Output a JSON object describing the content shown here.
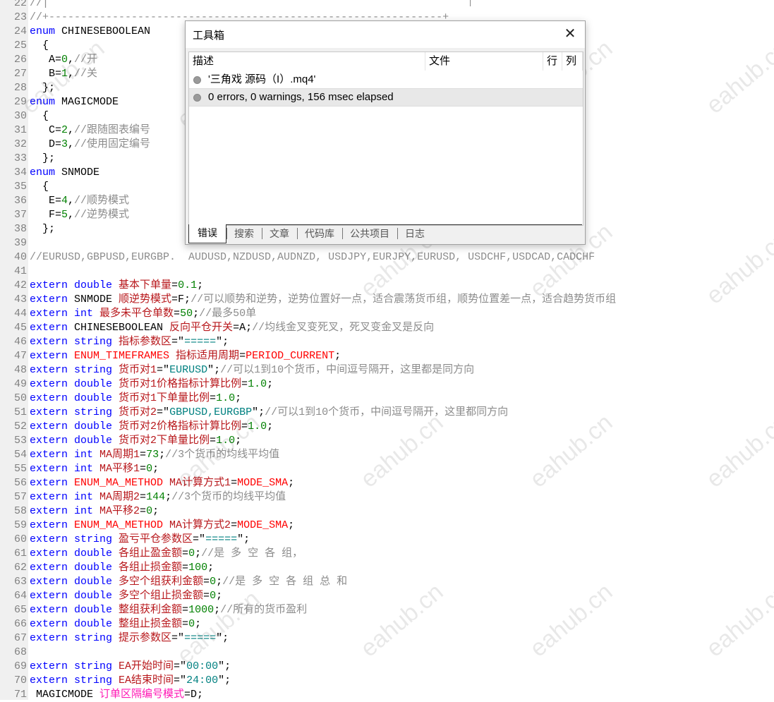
{
  "editor": {
    "lines": [
      {
        "no": "22",
        "seg": [
          [
            "c",
            "//|"
          ]
        ],
        "vbar": true
      },
      {
        "no": "23",
        "seg": [
          [
            "c",
            "//+--------------------------------------------------------------+"
          ]
        ]
      },
      {
        "no": "24",
        "seg": [
          [
            "k",
            "enum"
          ],
          [
            "p",
            " CHINESEBOOLEAN"
          ]
        ]
      },
      {
        "no": "25",
        "seg": [
          [
            "p",
            "  {"
          ]
        ]
      },
      {
        "no": "26",
        "seg": [
          [
            "p",
            "   A="
          ],
          [
            "n",
            "0"
          ],
          [
            "p",
            ","
          ],
          [
            "c",
            "//开"
          ]
        ]
      },
      {
        "no": "27",
        "seg": [
          [
            "p",
            "   B="
          ],
          [
            "n",
            "1"
          ],
          [
            "p",
            ","
          ],
          [
            "c",
            "//关"
          ]
        ]
      },
      {
        "no": "28",
        "seg": [
          [
            "p",
            "  };"
          ]
        ]
      },
      {
        "no": "29",
        "seg": [
          [
            "k",
            "enum"
          ],
          [
            "p",
            " MAGICMODE"
          ]
        ]
      },
      {
        "no": "30",
        "seg": [
          [
            "p",
            "  {"
          ]
        ]
      },
      {
        "no": "31",
        "seg": [
          [
            "p",
            "   C="
          ],
          [
            "n",
            "2"
          ],
          [
            "p",
            ","
          ],
          [
            "c",
            "//跟随图表编号"
          ]
        ]
      },
      {
        "no": "32",
        "seg": [
          [
            "p",
            "   D="
          ],
          [
            "n",
            "3"
          ],
          [
            "p",
            ","
          ],
          [
            "c",
            "//使用固定编号"
          ]
        ]
      },
      {
        "no": "33",
        "seg": [
          [
            "p",
            "  };"
          ]
        ]
      },
      {
        "no": "34",
        "seg": [
          [
            "k",
            "enum"
          ],
          [
            "p",
            " SNMODE"
          ]
        ]
      },
      {
        "no": "35",
        "seg": [
          [
            "p",
            "  {"
          ]
        ]
      },
      {
        "no": "36",
        "seg": [
          [
            "p",
            "   E="
          ],
          [
            "n",
            "4"
          ],
          [
            "p",
            ","
          ],
          [
            "c",
            "//顺势模式"
          ]
        ]
      },
      {
        "no": "37",
        "seg": [
          [
            "p",
            "   F="
          ],
          [
            "n",
            "5"
          ],
          [
            "p",
            ","
          ],
          [
            "c",
            "//逆势模式"
          ]
        ]
      },
      {
        "no": "38",
        "seg": [
          [
            "p",
            "  };"
          ]
        ]
      },
      {
        "no": "39",
        "seg": []
      },
      {
        "no": "40",
        "seg": [
          [
            "c",
            "//EURUSD,GBPUSD,EURGBP.  AUDUSD,NZDUSD,AUDNZD, USDJPY,EURJPY,EURUSD, USDCHF,USDCAD,CADCHF"
          ]
        ]
      },
      {
        "no": "41",
        "seg": []
      },
      {
        "no": "42",
        "seg": [
          [
            "k",
            "extern double "
          ],
          [
            "v",
            "基本下单量"
          ],
          [
            "p",
            "="
          ],
          [
            "n",
            "0.1"
          ],
          [
            "p",
            ";"
          ]
        ]
      },
      {
        "no": "43",
        "seg": [
          [
            "k",
            "extern "
          ],
          [
            "t",
            "SNMODE "
          ],
          [
            "v",
            "顺逆势模式"
          ],
          [
            "p",
            "=F;"
          ],
          [
            "c",
            "//可以顺势和逆势，逆势位置好一点，适合震荡货币组，顺势位置差一点，适合趋势货币组"
          ]
        ]
      },
      {
        "no": "44",
        "seg": [
          [
            "k",
            "extern int "
          ],
          [
            "v",
            "最多未平仓单数"
          ],
          [
            "p",
            "="
          ],
          [
            "n",
            "50"
          ],
          [
            "p",
            ";"
          ],
          [
            "c",
            "//最多50单"
          ]
        ]
      },
      {
        "no": "45",
        "seg": [
          [
            "k",
            "extern "
          ],
          [
            "t",
            "CHINESEBOOLEAN "
          ],
          [
            "v",
            "反向平仓开关"
          ],
          [
            "p",
            "=A;"
          ],
          [
            "c",
            "//均线金叉变死叉，死叉变金叉是反向"
          ]
        ]
      },
      {
        "no": "46",
        "seg": [
          [
            "k",
            "extern string "
          ],
          [
            "v",
            "指标参数区"
          ],
          [
            "p",
            "=\""
          ],
          [
            "s",
            "====="
          ],
          [
            "p",
            "\";"
          ]
        ]
      },
      {
        "no": "47",
        "seg": [
          [
            "k",
            "extern "
          ],
          [
            "e",
            "ENUM_TIMEFRAMES "
          ],
          [
            "v",
            "指标适用周期"
          ],
          [
            "p",
            "="
          ],
          [
            "e",
            "PERIOD_CURRENT"
          ],
          [
            "p",
            ";"
          ]
        ]
      },
      {
        "no": "48",
        "seg": [
          [
            "k",
            "extern string "
          ],
          [
            "v",
            "货币对1"
          ],
          [
            "p",
            "=\""
          ],
          [
            "s",
            "EURUSD"
          ],
          [
            "p",
            "\";"
          ],
          [
            "c",
            "//可以1到10个货币，中间逗号隔开，这里都是同方向"
          ]
        ]
      },
      {
        "no": "49",
        "seg": [
          [
            "k",
            "extern double "
          ],
          [
            "v",
            "货币对1价格指标计算比例"
          ],
          [
            "p",
            "="
          ],
          [
            "n",
            "1.0"
          ],
          [
            "p",
            ";"
          ]
        ]
      },
      {
        "no": "50",
        "seg": [
          [
            "k",
            "extern double "
          ],
          [
            "v",
            "货币对1下单量比例"
          ],
          [
            "p",
            "="
          ],
          [
            "n",
            "1.0"
          ],
          [
            "p",
            ";"
          ]
        ]
      },
      {
        "no": "51",
        "seg": [
          [
            "k",
            "extern string "
          ],
          [
            "v",
            "货币对2"
          ],
          [
            "p",
            "=\""
          ],
          [
            "s",
            "GBPUSD,EURGBP"
          ],
          [
            "p",
            "\";"
          ],
          [
            "c",
            "//可以1到10个货币，中间逗号隔开，这里都同方向"
          ]
        ]
      },
      {
        "no": "52",
        "seg": [
          [
            "k",
            "extern double "
          ],
          [
            "v",
            "货币对2价格指标计算比例"
          ],
          [
            "p",
            "="
          ],
          [
            "n",
            "1.0"
          ],
          [
            "p",
            ";"
          ]
        ]
      },
      {
        "no": "53",
        "seg": [
          [
            "k",
            "extern double "
          ],
          [
            "v",
            "货币对2下单量比例"
          ],
          [
            "p",
            "="
          ],
          [
            "n",
            "1.0"
          ],
          [
            "p",
            ";"
          ]
        ]
      },
      {
        "no": "54",
        "seg": [
          [
            "k",
            "extern int "
          ],
          [
            "v",
            "MA周期1"
          ],
          [
            "p",
            "="
          ],
          [
            "n",
            "73"
          ],
          [
            "p",
            ";"
          ],
          [
            "c",
            "//3个货币的均线平均值"
          ]
        ]
      },
      {
        "no": "55",
        "seg": [
          [
            "k",
            "extern int "
          ],
          [
            "v",
            "MA平移1"
          ],
          [
            "p",
            "="
          ],
          [
            "n",
            "0"
          ],
          [
            "p",
            ";"
          ]
        ]
      },
      {
        "no": "56",
        "seg": [
          [
            "k",
            "extern "
          ],
          [
            "e",
            "ENUM_MA_METHOD "
          ],
          [
            "v",
            "MA计算方式1"
          ],
          [
            "p",
            "="
          ],
          [
            "e",
            "MODE_SMA"
          ],
          [
            "p",
            ";"
          ]
        ]
      },
      {
        "no": "57",
        "seg": [
          [
            "k",
            "extern int "
          ],
          [
            "v",
            "MA周期2"
          ],
          [
            "p",
            "="
          ],
          [
            "n",
            "144"
          ],
          [
            "p",
            ";"
          ],
          [
            "c",
            "//3个货币的均线平均值"
          ]
        ]
      },
      {
        "no": "58",
        "seg": [
          [
            "k",
            "extern int "
          ],
          [
            "v",
            "MA平移2"
          ],
          [
            "p",
            "="
          ],
          [
            "n",
            "0"
          ],
          [
            "p",
            ";"
          ]
        ]
      },
      {
        "no": "59",
        "seg": [
          [
            "k",
            "extern "
          ],
          [
            "e",
            "ENUM_MA_METHOD "
          ],
          [
            "v",
            "MA计算方式2"
          ],
          [
            "p",
            "="
          ],
          [
            "e",
            "MODE_SMA"
          ],
          [
            "p",
            ";"
          ]
        ]
      },
      {
        "no": "60",
        "seg": [
          [
            "k",
            "extern string "
          ],
          [
            "v",
            "盈亏平仓参数区"
          ],
          [
            "p",
            "=\""
          ],
          [
            "s",
            "====="
          ],
          [
            "p",
            "\";"
          ]
        ]
      },
      {
        "no": "61",
        "seg": [
          [
            "k",
            "extern double "
          ],
          [
            "v",
            "各组止盈金额"
          ],
          [
            "p",
            "="
          ],
          [
            "n",
            "0"
          ],
          [
            "p",
            ";"
          ],
          [
            "c",
            "//是 多 空 各 组，"
          ]
        ]
      },
      {
        "no": "62",
        "seg": [
          [
            "k",
            "extern double "
          ],
          [
            "v",
            "各组止损金额"
          ],
          [
            "p",
            "="
          ],
          [
            "n",
            "100"
          ],
          [
            "p",
            ";"
          ]
        ]
      },
      {
        "no": "63",
        "seg": [
          [
            "k",
            "extern double "
          ],
          [
            "v",
            "多空个组获利金额"
          ],
          [
            "p",
            "="
          ],
          [
            "n",
            "0"
          ],
          [
            "p",
            ";"
          ],
          [
            "c",
            "//是 多 空 各 组 总 和"
          ]
        ]
      },
      {
        "no": "64",
        "seg": [
          [
            "k",
            "extern double "
          ],
          [
            "v",
            "多空个组止损金额"
          ],
          [
            "p",
            "="
          ],
          [
            "n",
            "0"
          ],
          [
            "p",
            ";"
          ]
        ]
      },
      {
        "no": "65",
        "seg": [
          [
            "k",
            "extern double "
          ],
          [
            "v",
            "整组获利金额"
          ],
          [
            "p",
            "="
          ],
          [
            "n",
            "1000"
          ],
          [
            "p",
            ";"
          ],
          [
            "c",
            "//所有的货币盈利"
          ]
        ]
      },
      {
        "no": "66",
        "seg": [
          [
            "k",
            "extern double "
          ],
          [
            "v",
            "整组止损金额"
          ],
          [
            "p",
            "="
          ],
          [
            "n",
            "0"
          ],
          [
            "p",
            ";"
          ]
        ]
      },
      {
        "no": "67",
        "seg": [
          [
            "k",
            "extern string "
          ],
          [
            "v",
            "提示参数区"
          ],
          [
            "p",
            "=\""
          ],
          [
            "s",
            "====="
          ],
          [
            "p",
            "\";"
          ]
        ]
      },
      {
        "no": "68",
        "seg": []
      },
      {
        "no": "69",
        "seg": [
          [
            "k",
            "extern string "
          ],
          [
            "v",
            "EA开始时间"
          ],
          [
            "p",
            "=\""
          ],
          [
            "s",
            "00:00"
          ],
          [
            "p",
            "\";"
          ]
        ]
      },
      {
        "no": "70",
        "seg": [
          [
            "k",
            "extern string "
          ],
          [
            "v",
            "EA结束时间"
          ],
          [
            "p",
            "=\""
          ],
          [
            "s",
            "24:00"
          ],
          [
            "p",
            "\";"
          ]
        ]
      },
      {
        "no": "71",
        "seg": [
          [
            "p",
            " MAGICMODE "
          ],
          [
            "m",
            "订单区隔编号模式"
          ],
          [
            "p",
            "=D;"
          ]
        ]
      }
    ]
  },
  "toolbox": {
    "title": "工具箱",
    "close_icon": "close-icon",
    "columns": {
      "description": "描述",
      "file": "文件",
      "line": "行",
      "column": "列"
    },
    "rows": [
      {
        "text": "'三角戏 源码（I）.mq4'",
        "selected": false
      },
      {
        "text": "0 errors, 0 warnings, 156 msec elapsed",
        "selected": true
      }
    ],
    "tabs": [
      "错误",
      "搜索",
      "文章",
      "代码库",
      "公共项目",
      "日志"
    ],
    "active_tab": 0
  },
  "watermark": "eahub.cn",
  "colors": {
    "keyword": "#0000ff",
    "variable": "#b8181c",
    "number": "#008000",
    "string": "#008080",
    "comment": "#8c8c8c",
    "enum": "#ff0000"
  }
}
